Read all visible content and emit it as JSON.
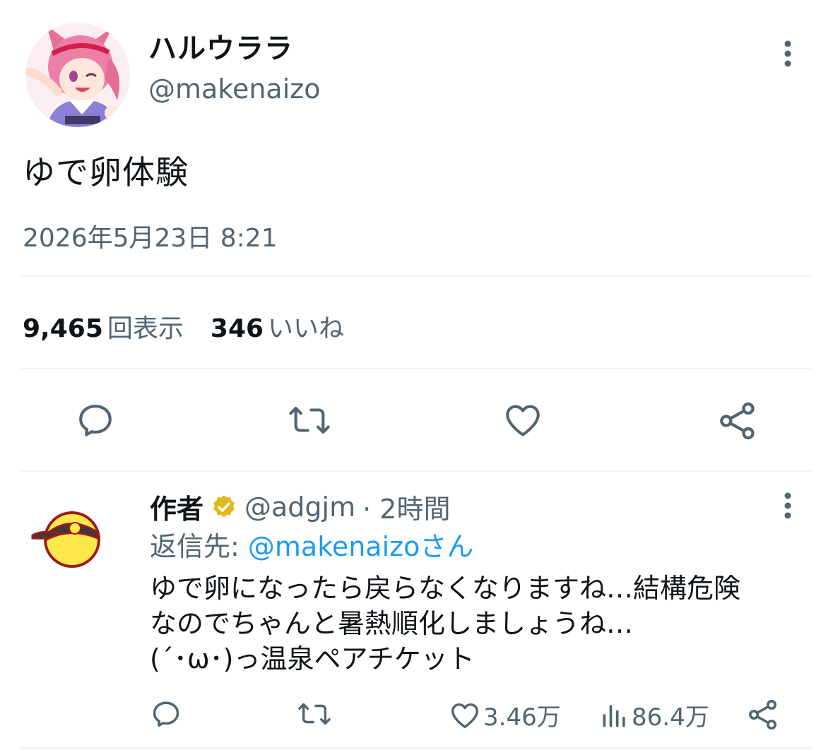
{
  "tweet": {
    "author": {
      "display_name": "ハルウララ",
      "handle": "@makenaizo"
    },
    "text": "ゆで卵体験",
    "timestamp": "2026年5月23日 8:21",
    "stats": {
      "views_count": "9,465",
      "views_label": "回表示",
      "likes_count": "346",
      "likes_label": "いいね"
    },
    "actions": [
      "reply-icon",
      "retweet-icon",
      "heart-icon",
      "share-icon"
    ]
  },
  "reply": {
    "author": {
      "display_name": "作者",
      "handle": "@adgjm",
      "time": "· 2時間"
    },
    "replying_prefix": "返信先: ",
    "replying_to": "@makenaizoさん",
    "text_lines": [
      "ゆで卵になったら戻らなくなりますね…結構危険",
      "なのでちゃんと暑熱順化しましょうね…",
      "(´･ω･)っ温泉ペアチケット"
    ],
    "counts": {
      "likes": "3.46万",
      "views": "86.4万"
    }
  },
  "colors": {
    "text": "#0f1419",
    "secondary": "#536471",
    "link": "#1d9bf0",
    "verified": "#e2b719",
    "divider": "#eff3f4"
  }
}
